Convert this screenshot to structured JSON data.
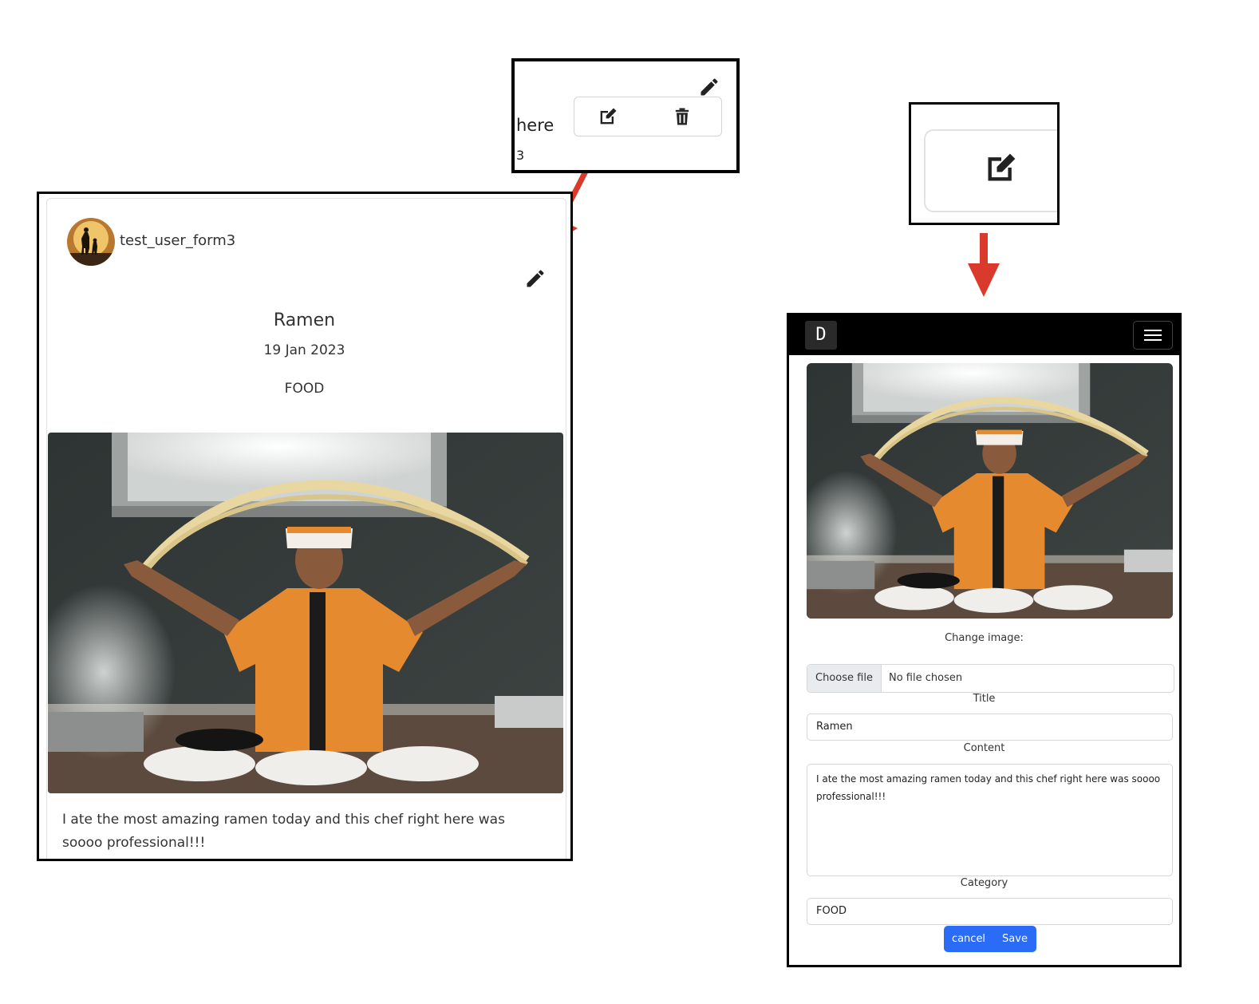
{
  "zoom_top_left": {
    "fragment_text": "here",
    "fragment_digit": "3"
  },
  "post_card": {
    "username": "test_user_form3",
    "title": "Ramen",
    "date": "19 Jan 2023",
    "category": "FOOD",
    "content": "I ate the most amazing ramen today and this chef right here was soooo professional!!!",
    "icons": [
      "pencil-icon",
      "edit-icon",
      "trash-icon"
    ]
  },
  "edit_form": {
    "brand": "D",
    "change_image_label": "Change image:",
    "choose_file_label": "Choose file",
    "file_status": "No file chosen",
    "title_label": "Title",
    "title_value": "Ramen",
    "content_label": "Content",
    "content_value": "I ate the most amazing ramen today and this chef right here was soooo professional!!!",
    "category_label": "Category",
    "category_value": "FOOD",
    "cancel_label": "cancel",
    "save_label": "Save"
  },
  "colors": {
    "arrow": "#d93a2b",
    "primary_button": "#2b6cf6",
    "navbar": "#000000"
  }
}
